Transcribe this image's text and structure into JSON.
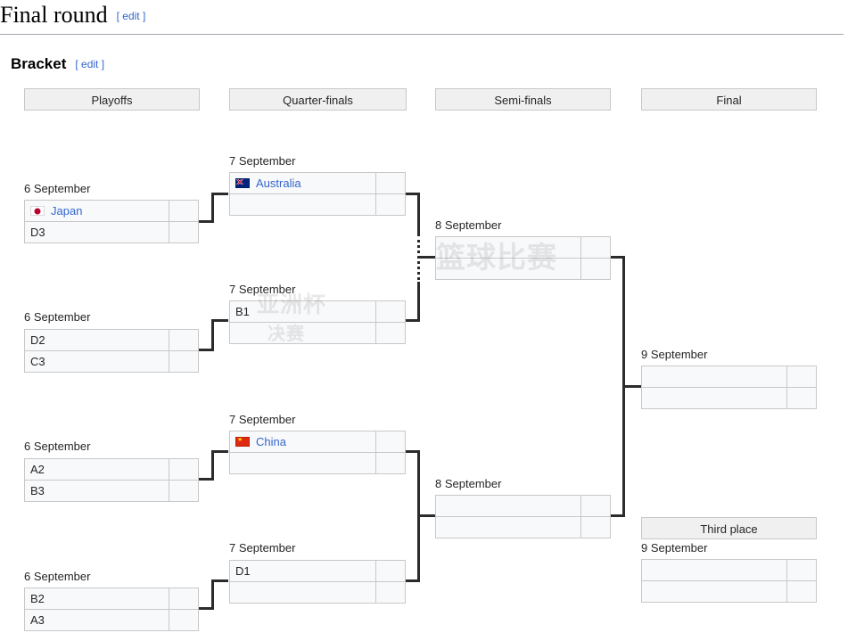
{
  "header": {
    "title": "Final round",
    "edit_label": "[ edit ]",
    "section_title": "Bracket",
    "section_edit_label": "[ edit ]"
  },
  "rounds": [
    {
      "label": "Playoffs"
    },
    {
      "label": "Quarter-finals"
    },
    {
      "label": "Semi-finals"
    },
    {
      "label": "Final"
    }
  ],
  "third_place": {
    "label": "Third place"
  },
  "dates": {
    "sep6": "6 September",
    "sep7": "7 September",
    "sep8": "8 September",
    "sep9": "9 September"
  },
  "matches": {
    "playoff1": {
      "date": "6 September",
      "teams": [
        {
          "name": "Japan",
          "flag": "japan-flag-icon",
          "score": "",
          "link": true
        },
        {
          "name": "D3",
          "flag": "",
          "score": "",
          "link": false
        }
      ]
    },
    "playoff2": {
      "date": "6 September",
      "teams": [
        {
          "name": "D2",
          "flag": "",
          "score": "",
          "link": false
        },
        {
          "name": "C3",
          "flag": "",
          "score": "",
          "link": false
        }
      ]
    },
    "playoff3": {
      "date": "6 September",
      "teams": [
        {
          "name": "A2",
          "flag": "",
          "score": "",
          "link": false
        },
        {
          "name": "B3",
          "flag": "",
          "score": "",
          "link": false
        }
      ]
    },
    "playoff4": {
      "date": "6 September",
      "teams": [
        {
          "name": "B2",
          "flag": "",
          "score": "",
          "link": false
        },
        {
          "name": "A3",
          "flag": "",
          "score": "",
          "link": false
        }
      ]
    },
    "quarter1": {
      "date": "7 September",
      "teams": [
        {
          "name": "Australia",
          "flag": "australia-flag-icon",
          "score": "",
          "link": true
        },
        {
          "name": "",
          "flag": "",
          "score": "",
          "link": false
        }
      ]
    },
    "quarter2": {
      "date": "7 September",
      "teams": [
        {
          "name": "B1",
          "flag": "",
          "score": "",
          "link": false
        },
        {
          "name": "",
          "flag": "",
          "score": "",
          "link": false
        }
      ]
    },
    "quarter3": {
      "date": "7 September",
      "teams": [
        {
          "name": "China",
          "flag": "china-flag-icon",
          "score": "",
          "link": true
        },
        {
          "name": "",
          "flag": "",
          "score": "",
          "link": false
        }
      ]
    },
    "quarter4": {
      "date": "7 September",
      "teams": [
        {
          "name": "D1",
          "flag": "",
          "score": "",
          "link": false
        },
        {
          "name": "",
          "flag": "",
          "score": "",
          "link": false
        }
      ]
    },
    "semi1": {
      "date": "8 September",
      "teams": [
        {
          "name": "",
          "flag": "",
          "score": "",
          "link": false
        },
        {
          "name": "",
          "flag": "",
          "score": "",
          "link": false
        }
      ]
    },
    "semi2": {
      "date": "8 September",
      "teams": [
        {
          "name": "",
          "flag": "",
          "score": "",
          "link": false
        },
        {
          "name": "",
          "flag": "",
          "score": "",
          "link": false
        }
      ]
    },
    "final": {
      "date": "9 September",
      "teams": [
        {
          "name": "",
          "flag": "",
          "score": "",
          "link": false
        },
        {
          "name": "",
          "flag": "",
          "score": "",
          "link": false
        }
      ]
    },
    "third": {
      "date": "9 September",
      "teams": [
        {
          "name": "",
          "flag": "",
          "score": "",
          "link": false
        },
        {
          "name": "",
          "flag": "",
          "score": "",
          "link": false
        }
      ]
    }
  },
  "watermark": {
    "line1": "亚洲杯",
    "line2": "决赛",
    "line3": "篮球比赛"
  },
  "colors": {
    "link": "#3366cc",
    "box_border": "#c8c8c8",
    "box_fill": "#f8f9fa",
    "header_fill": "#f0f0f0",
    "line": "#2b2b2b"
  }
}
